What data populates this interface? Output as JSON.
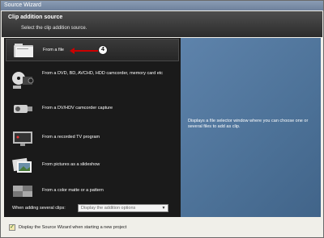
{
  "window": {
    "title": "Source Wizard"
  },
  "header": {
    "title": "Clip addition source",
    "subtitle": "Select the clip addition source."
  },
  "options": [
    {
      "label": "From a file",
      "icon": "folder-icon"
    },
    {
      "label": "From a DVD, BD, AVCHD, HDD camcorder, memory card etc",
      "icon": "disc-camcorder-icon"
    },
    {
      "label": "From a DV/HDV camcorder capture",
      "icon": "camcorder-icon"
    },
    {
      "label": "From a recorded TV program",
      "icon": "tv-icon"
    },
    {
      "label": "From pictures as a slideshow",
      "icon": "slideshow-icon"
    },
    {
      "label": "From a color matte or a pattern",
      "icon": "color-pattern-icon"
    }
  ],
  "annotation": {
    "number": "4"
  },
  "description": "Displays a file selector window where you can choose one or several files to add as clip.",
  "several_clips": {
    "label": "When adding several clips:",
    "value": "Display the addition options"
  },
  "footer": {
    "checkbox_checked": true,
    "checkbox_label": "Display the Source Wizard when starting a new project"
  },
  "colors": {
    "panel": "#1a1a1a",
    "info_panel": "#4c7197",
    "annotation_arrow": "#cc0000"
  }
}
